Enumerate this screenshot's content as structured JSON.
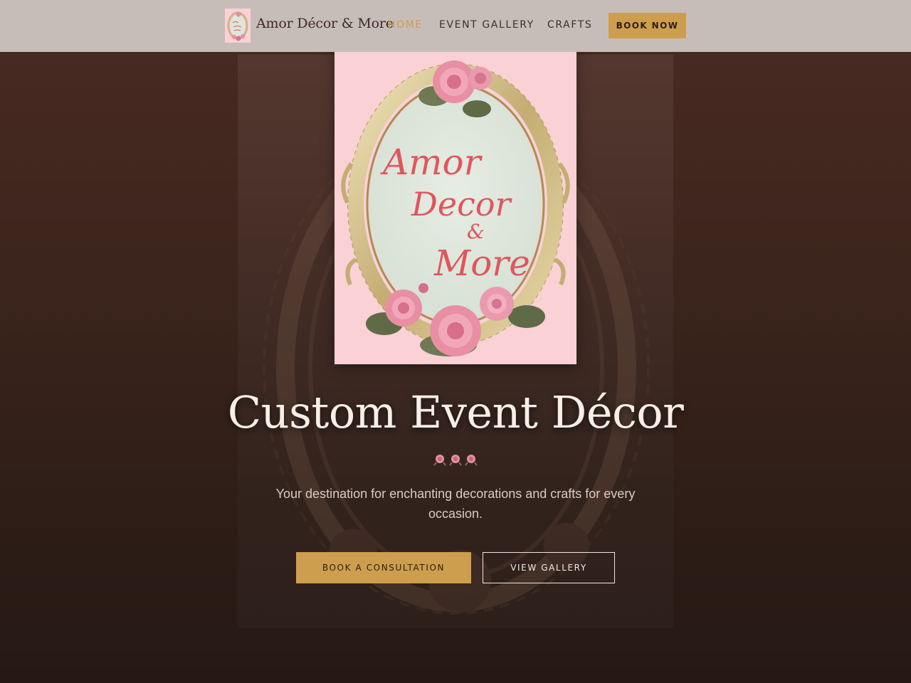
{
  "brand": {
    "name": "Amor Décor & More",
    "logo_text": [
      "Amor",
      "Decor",
      "&",
      "More"
    ]
  },
  "nav": {
    "links": [
      {
        "label": "HOME",
        "active": true
      },
      {
        "label": "EVENT GALLERY",
        "active": false
      },
      {
        "label": "CRAFTS",
        "active": false
      }
    ],
    "book_now_label": "BOOK NOW"
  },
  "hero": {
    "title": "Custom Event Décor",
    "divider_icon": "rose-icon",
    "subtitle": "Your destination for enchanting decorations and crafts for every occasion.",
    "primary_button": "BOOK A CONSULTATION",
    "secondary_button": "VIEW GALLERY"
  },
  "colors": {
    "accent_gold": "#cd9e4d",
    "nav_background": "#c7bdb8",
    "hero_background": "#3a241c",
    "logo_pink": "#fad1d4",
    "logo_script": "#e0565e"
  }
}
